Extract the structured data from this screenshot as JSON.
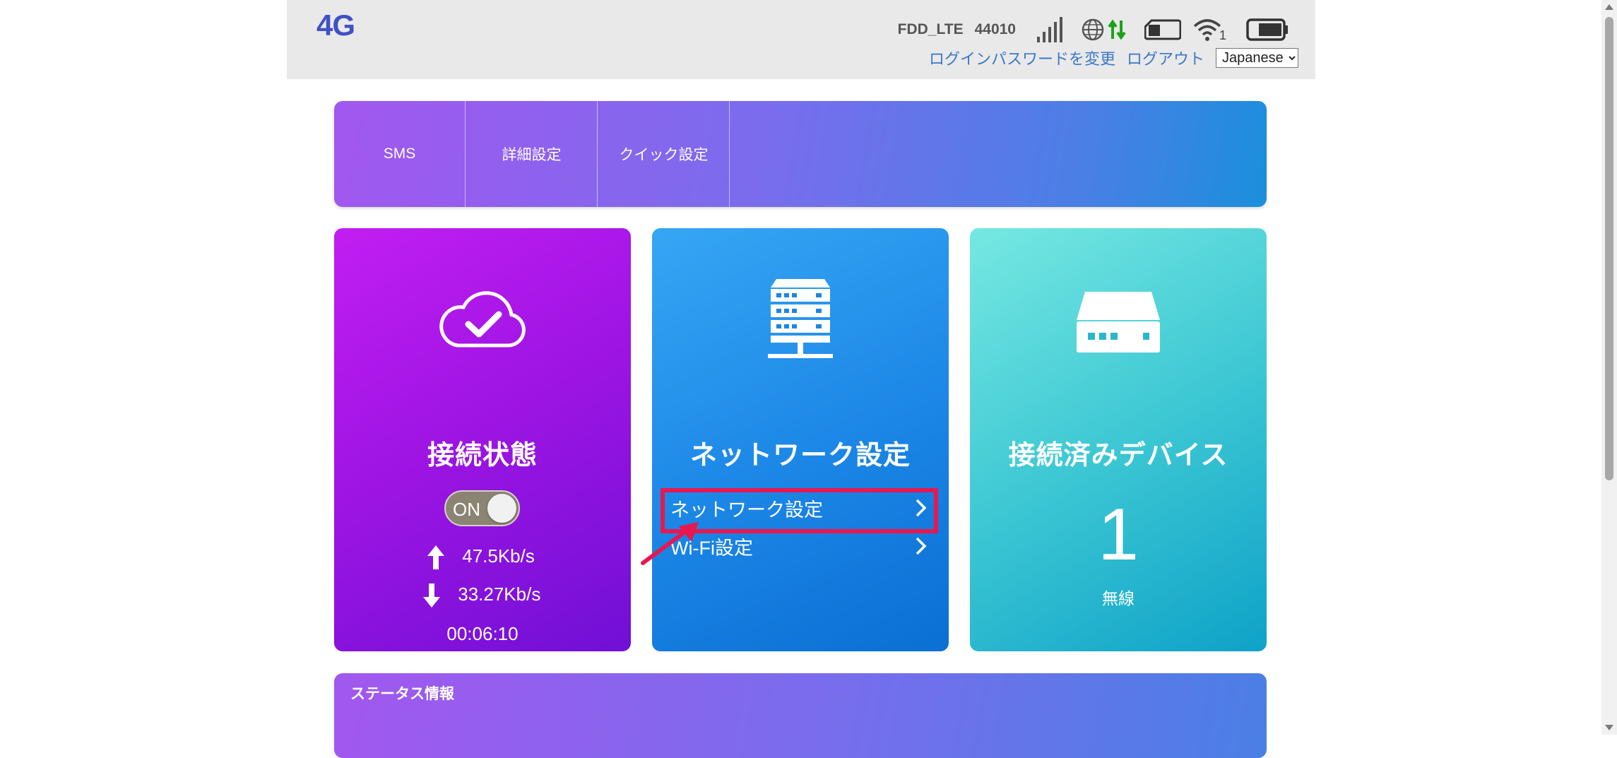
{
  "header": {
    "logo": "4G",
    "network_type": "FDD_LTE",
    "operator_code": "44010",
    "roaming_indicator": "1",
    "change_password_link": "ログインパスワードを変更",
    "logout_link": "ログアウト",
    "language_selected": "Japanese",
    "icons": [
      "signal-strength-icon",
      "internet-globe-icon",
      "data-transfer-icon",
      "sim-card-icon",
      "wifi-icon",
      "battery-icon"
    ]
  },
  "menu": {
    "items": [
      {
        "label": "SMS"
      },
      {
        "label": "詳細設定"
      },
      {
        "label": "クイック設定"
      }
    ]
  },
  "connection_card": {
    "title": "接続状態",
    "toggle_label": "ON",
    "upload_rate": "47.5Kb/s",
    "download_rate": "33.27Kb/s",
    "duration": "00:06:10",
    "icon": "cloud-check-icon"
  },
  "network_card": {
    "title": "ネットワーク設定",
    "icon": "server-icon",
    "links": [
      {
        "label": "ネットワーク設定"
      },
      {
        "label": "Wi-Fi設定"
      }
    ]
  },
  "devices_card": {
    "title": "接続済みデバイス",
    "icon": "router-icon",
    "count": "1",
    "type_label": "無線"
  },
  "status_panel": {
    "title": "ステータス情報"
  },
  "colors": {
    "highlight": "#e8174f",
    "link": "#3a78c8",
    "logo": "#3f51c4"
  }
}
